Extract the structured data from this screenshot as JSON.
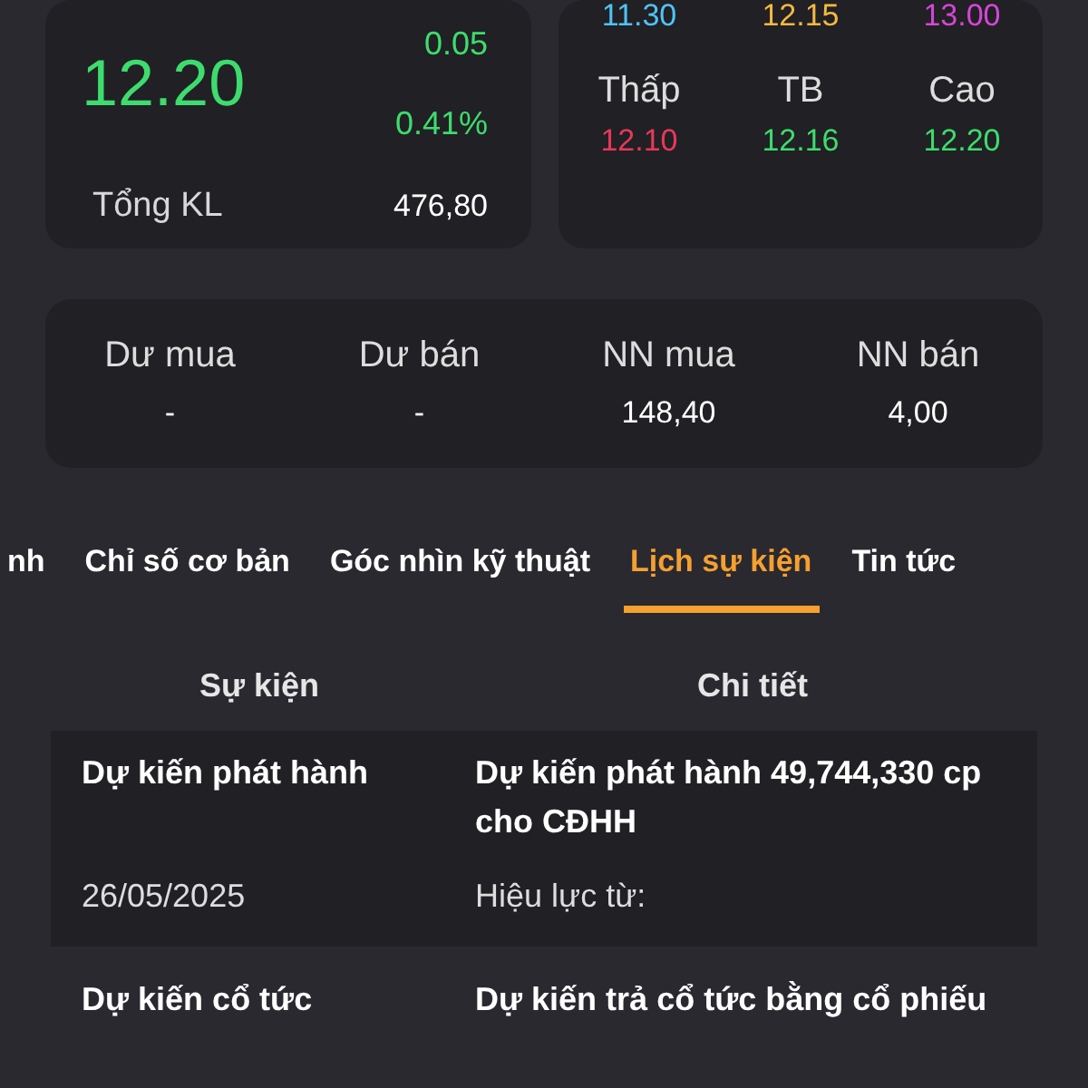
{
  "price": {
    "value": "12.20",
    "change": "0.05",
    "change_pct": "0.41%",
    "color": "#3ddc6e"
  },
  "volume": {
    "label": "Tổng KL",
    "value": "476,80"
  },
  "ref_prices": [
    {
      "value": "11.30",
      "color": "#4fc3f7"
    },
    {
      "value": "12.15",
      "color": "#f5b841"
    },
    {
      "value": "13.00",
      "color": "#d446d6"
    }
  ],
  "range": [
    {
      "label": "Thấp",
      "value": "12.10",
      "color": "#e8385a"
    },
    {
      "label": "TB",
      "value": "12.16",
      "color": "#3ddc6e"
    },
    {
      "label": "Cao",
      "value": "12.20",
      "color": "#3ddc6e"
    }
  ],
  "orders": [
    {
      "label": "Dư mua",
      "value": "-"
    },
    {
      "label": "Dư bán",
      "value": "-"
    },
    {
      "label": "NN mua",
      "value": "148,40"
    },
    {
      "label": "NN bán",
      "value": "4,00"
    }
  ],
  "tabs": [
    {
      "label": "nh",
      "selected": false
    },
    {
      "label": "Chỉ số cơ bản",
      "selected": false
    },
    {
      "label": "Góc nhìn kỹ thuật",
      "selected": false
    },
    {
      "label": "Lịch sự kiện",
      "selected": true
    },
    {
      "label": "Tin tức",
      "selected": false
    }
  ],
  "events": {
    "columns": [
      "Sự kiện",
      "Chi tiết"
    ],
    "rows": [
      {
        "title": "Dự kiến phát hành",
        "detail": "Dự kiến phát hành 49,744,330 cp cho CĐHH",
        "date": "26/05/2025",
        "effective": "Hiệu lực từ:"
      },
      {
        "title": "Dự kiến cổ tức",
        "detail": "Dự kiến trả cổ tức bằng cổ phiếu"
      }
    ]
  }
}
